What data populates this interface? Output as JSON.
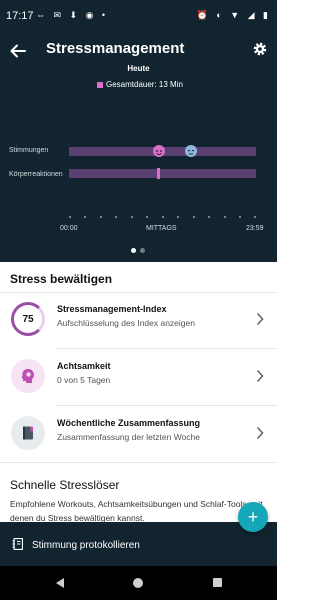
{
  "status_bar": {
    "time": "17:17",
    "left_icons": "⇔ ✉ ⬇ ◉ •",
    "right_icons": "⏰ ◐ ▼ ◢ ▮"
  },
  "header": {
    "title": "Stressmanagement",
    "day_label": "Heute",
    "legend_label": "Gesamtdauer: 13 Min"
  },
  "timeline": {
    "rows": [
      {
        "label": "Stimmungen"
      },
      {
        "label": "Körperreaktionen"
      }
    ],
    "axis": {
      "start": "00:00",
      "mid": "MITTAGS",
      "end": "23:59"
    }
  },
  "manage": {
    "title": "Stress bewältigen",
    "items": [
      {
        "value": "75",
        "title": "Stressmanagement-Index",
        "subtitle": "Aufschlüsselung des Index anzeigen"
      },
      {
        "title": "Achtsamkeit",
        "subtitle": "0 von 5 Tagen"
      },
      {
        "title": "Wöchentliche Zusammenfassung",
        "subtitle": "Zusammenfassung der letzten Woche"
      }
    ]
  },
  "quick": {
    "title": "Schnelle Stresslöser",
    "description": "Empfohlene Workouts, Achtsamkeitsübungen und Schlaf-Tools, mit denen du Stress bewältigen kannst."
  },
  "action_bar": {
    "label": "Stimmung protokollieren",
    "fab": "+"
  },
  "colors": {
    "header_bg": "#112430",
    "accent_pink": "#d96fc8",
    "track_purple": "#5a3f71",
    "fab_teal": "#13a7b8"
  }
}
